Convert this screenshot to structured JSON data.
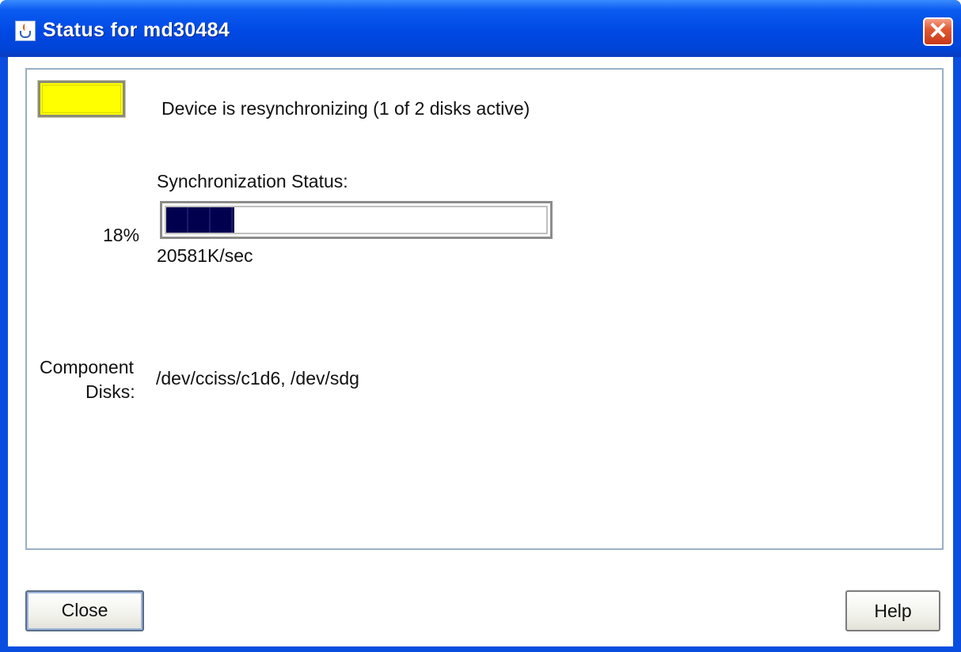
{
  "window": {
    "title": "Status for md30484",
    "close_glyph": "✕"
  },
  "status": {
    "indicator_color": "#ffff00",
    "message": "Device is resynchronizing (1 of 2 disks active)"
  },
  "sync": {
    "label": "Synchronization Status:",
    "percent_text": "18%",
    "progress_fraction": 0.18,
    "rate": "20581K/sec",
    "bar_color": "#00004e"
  },
  "components": {
    "label_line1": "Component",
    "label_line2": "Disks:",
    "value": "/dev/cciss/c1d6, /dev/sdg"
  },
  "buttons": {
    "close": "Close",
    "help": "Help"
  },
  "icons": {
    "app": "java-coffee-cup-icon",
    "close": "close-icon"
  }
}
